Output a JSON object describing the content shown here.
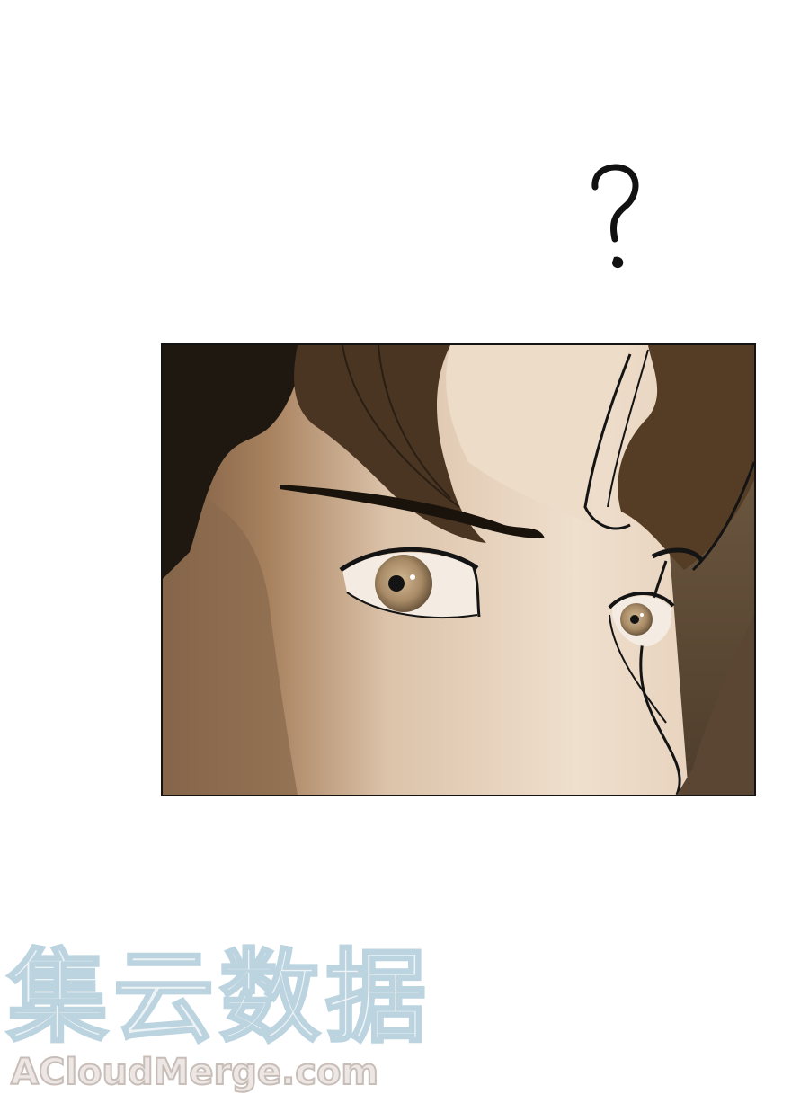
{
  "sfx": {
    "text": "?"
  },
  "panel": {
    "subject": "close-up-eyes",
    "colors": {
      "skin_light": "#ead8c4",
      "skin_shadow": "#8a6a4e",
      "hair_dark": "#3a2a1c",
      "hair_brown": "#5a4028",
      "line": "#141414",
      "background_right": "#5a4632"
    }
  },
  "watermark": {
    "chinese": "集云数据",
    "latin": "ACloudMerge.com"
  }
}
